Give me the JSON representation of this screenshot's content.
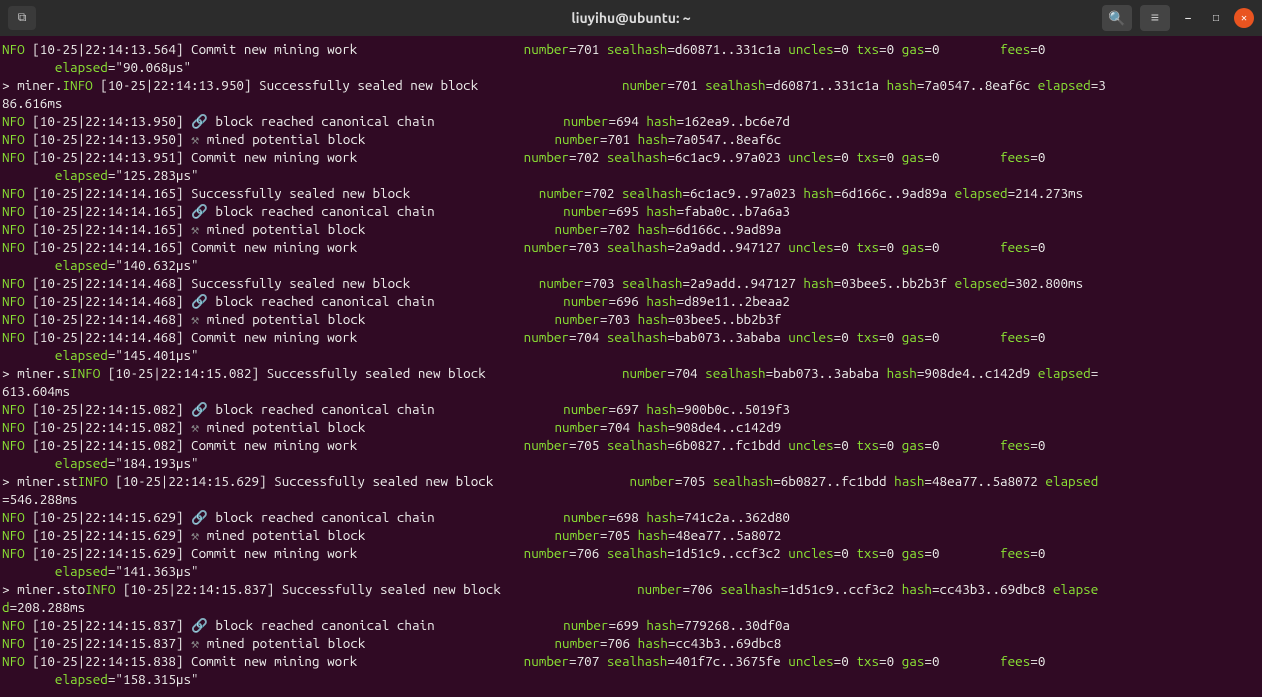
{
  "titlebar": {
    "title": "liuyihu@ubuntu: ~"
  },
  "icons": {
    "newtab": "⧉",
    "search": "🔍",
    "menu": "≡",
    "minimize": "─",
    "maximize": "□",
    "close": "✕",
    "chain": "🔗",
    "hammer": "⚒"
  },
  "lines": [
    {
      "t": "commit",
      "pre": "",
      "ts": "10-25|22:14:13.564",
      "msg": "Commit new mining work",
      "number": "701",
      "sealhash": "d60871..331c1a",
      "uncles": "0",
      "txs": "0",
      "gas": "0",
      "fees": "0",
      "elapsed": "\"90.068µs\""
    },
    {
      "t": "sealed",
      "pre": "> miner.",
      "ts": "10-25|22:14:13.950",
      "msg": "Successfully sealed new block",
      "number": "701",
      "sealhash": "d60871..331c1a",
      "hash": "7a0547..8eaf6c",
      "elapsed_tail": "3",
      "wrap": "86.616ms",
      "col": 1
    },
    {
      "t": "reached",
      "ts": "10-25|22:14:13.950",
      "msg": "block reached canonical chain",
      "number": "694",
      "hash": "162ea9..bc6e7d"
    },
    {
      "t": "mined",
      "ts": "10-25|22:14:13.950",
      "msg": "mined potential block",
      "number": "701",
      "hash": "7a0547..8eaf6c"
    },
    {
      "t": "commit",
      "pre": "",
      "ts": "10-25|22:14:13.951",
      "msg": "Commit new mining work",
      "number": "702",
      "sealhash": "6c1ac9..97a023",
      "uncles": "0",
      "txs": "0",
      "gas": "0",
      "fees": "0",
      "elapsed": "\"125.283µs\""
    },
    {
      "t": "sealed",
      "pre": "",
      "ts": "10-25|22:14:14.165",
      "msg": "Successfully sealed new block",
      "number": "702",
      "sealhash": "6c1ac9..97a023",
      "hash": "6d166c..9ad89a",
      "elapsed_tail": "214.273ms",
      "col": 0
    },
    {
      "t": "reached",
      "ts": "10-25|22:14:14.165",
      "msg": "block reached canonical chain",
      "number": "695",
      "hash": "faba0c..b7a6a3"
    },
    {
      "t": "mined",
      "ts": "10-25|22:14:14.165",
      "msg": "mined potential block",
      "number": "702",
      "hash": "6d166c..9ad89a"
    },
    {
      "t": "commit",
      "pre": "",
      "ts": "10-25|22:14:14.165",
      "msg": "Commit new mining work",
      "number": "703",
      "sealhash": "2a9add..947127",
      "uncles": "0",
      "txs": "0",
      "gas": "0",
      "fees": "0",
      "elapsed": "\"140.632µs\""
    },
    {
      "t": "sealed",
      "pre": "",
      "ts": "10-25|22:14:14.468",
      "msg": "Successfully sealed new block",
      "number": "703",
      "sealhash": "2a9add..947127",
      "hash": "03bee5..bb2b3f",
      "elapsed_tail": "302.800ms",
      "col": 0
    },
    {
      "t": "reached",
      "ts": "10-25|22:14:14.468",
      "msg": "block reached canonical chain",
      "number": "696",
      "hash": "d89e11..2beaa2"
    },
    {
      "t": "mined",
      "ts": "10-25|22:14:14.468",
      "msg": "mined potential block",
      "number": "703",
      "hash": "03bee5..bb2b3f"
    },
    {
      "t": "commit",
      "pre": "",
      "ts": "10-25|22:14:14.468",
      "msg": "Commit new mining work",
      "number": "704",
      "sealhash": "bab073..3ababa",
      "uncles": "0",
      "txs": "0",
      "gas": "0",
      "fees": "0",
      "elapsed": "\"145.401µs\""
    },
    {
      "t": "sealed",
      "pre": "> miner.s",
      "ts": "10-25|22:14:15.082",
      "msg": "Successfully sealed new block",
      "number": "704",
      "sealhash": "bab073..3ababa",
      "hash": "908de4..c142d9",
      "elapsed_tail": "",
      "wrap": "613.604ms",
      "col": 1
    },
    {
      "t": "reached",
      "ts": "10-25|22:14:15.082",
      "msg": "block reached canonical chain",
      "number": "697",
      "hash": "900b0c..5019f3"
    },
    {
      "t": "mined",
      "ts": "10-25|22:14:15.082",
      "msg": "mined potential block",
      "number": "704",
      "hash": "908de4..c142d9"
    },
    {
      "t": "commit",
      "pre": "",
      "ts": "10-25|22:14:15.082",
      "msg": "Commit new mining work",
      "number": "705",
      "sealhash": "6b0827..fc1bdd",
      "uncles": "0",
      "txs": "0",
      "gas": "0",
      "fees": "0",
      "elapsed": "\"184.193µs\""
    },
    {
      "t": "sealed",
      "pre": "> miner.st",
      "ts": "10-25|22:14:15.629",
      "msg": "Successfully sealed new block",
      "number": "705",
      "sealhash": "6b0827..fc1bdd",
      "hash": "48ea77..5a8072",
      "elapsed_tail": "",
      "wrap": "=546.288ms",
      "col": 2
    },
    {
      "t": "reached",
      "ts": "10-25|22:14:15.629",
      "msg": "block reached canonical chain",
      "number": "698",
      "hash": "741c2a..362d80"
    },
    {
      "t": "mined",
      "ts": "10-25|22:14:15.629",
      "msg": "mined potential block",
      "number": "705",
      "hash": "48ea77..5a8072"
    },
    {
      "t": "commit",
      "pre": "",
      "ts": "10-25|22:14:15.629",
      "msg": "Commit new mining work",
      "number": "706",
      "sealhash": "1d51c9..ccf3c2",
      "uncles": "0",
      "txs": "0",
      "gas": "0",
      "fees": "0",
      "elapsed": "\"141.363µs\""
    },
    {
      "t": "sealed",
      "pre": "> miner.sto",
      "ts": "10-25|22:14:15.837",
      "msg": "Successfully sealed new block",
      "number": "706",
      "sealhash": "1d51c9..ccf3c2",
      "hash": "cc43b3..69dbc8",
      "elapsed_tail": "",
      "wrap": "=208.288ms",
      "col": 3
    },
    {
      "t": "reached",
      "ts": "10-25|22:14:15.837",
      "msg": "block reached canonical chain",
      "number": "699",
      "hash": "779268..30df0a"
    },
    {
      "t": "mined",
      "ts": "10-25|22:14:15.837",
      "msg": "mined potential block",
      "number": "706",
      "hash": "cc43b3..69dbc8"
    },
    {
      "t": "commit",
      "pre": "",
      "ts": "10-25|22:14:15.838",
      "msg": "Commit new mining work",
      "number": "707",
      "sealhash": "401f7c..3675fe",
      "uncles": "0",
      "txs": "0",
      "gas": "0",
      "fees": "0",
      "elapsed": "\"158.315µs\""
    }
  ],
  "labels": {
    "nfo": "NFO",
    "info": "INFO",
    "number": "number",
    "sealhash": "sealhash",
    "hash": "hash",
    "uncles": "uncles",
    "txs": "txs",
    "gas": "gas",
    "fees": "fees",
    "elapsed": "elapsed",
    "elapse": "elapse"
  }
}
